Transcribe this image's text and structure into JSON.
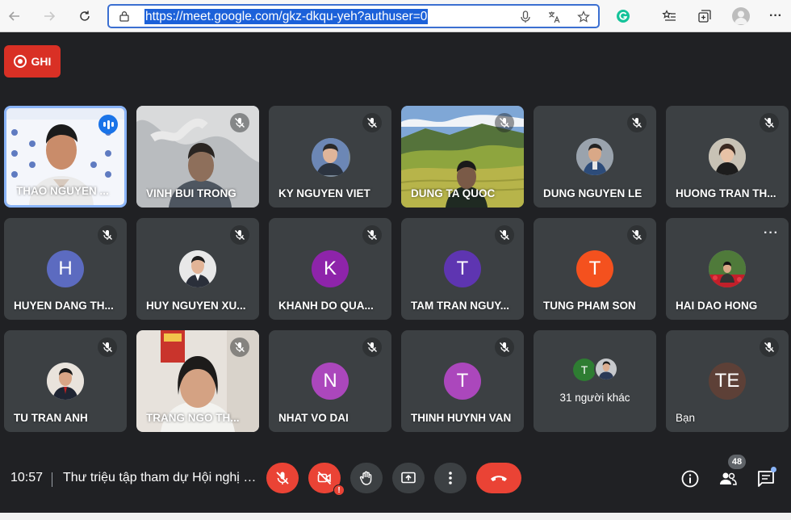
{
  "browser": {
    "url": "https://meet.google.com/gkz-dkqu-yeh?authuser=0"
  },
  "recording": {
    "label": "GHI",
    "color": "#d93025"
  },
  "tiles": [
    {
      "name": "THAO NGUYEN ...",
      "kind": "camera",
      "speaking": true
    },
    {
      "name": "VINH BUI TRONG",
      "kind": "camera",
      "muted": true
    },
    {
      "name": "KY NGUYEN VIET",
      "kind": "photo",
      "muted": true
    },
    {
      "name": "DUNG TA QUOC",
      "kind": "camera",
      "muted": true
    },
    {
      "name": "DUNG NGUYEN LE",
      "kind": "photo",
      "muted": true
    },
    {
      "name": "HUONG TRAN TH...",
      "kind": "photo",
      "muted": true
    },
    {
      "name": "HUYEN DANG TH...",
      "kind": "letter",
      "letter": "H",
      "color": "#5c6bc0",
      "muted": true
    },
    {
      "name": "HUY NGUYEN XU...",
      "kind": "photo",
      "muted": true
    },
    {
      "name": "KHANH DO QUA...",
      "kind": "letter",
      "letter": "K",
      "color": "#8e24aa",
      "muted": true
    },
    {
      "name": "TAM TRAN NGUY...",
      "kind": "letter",
      "letter": "T",
      "color": "#5e35b1",
      "muted": true
    },
    {
      "name": "TUNG PHAM SON",
      "kind": "letter",
      "letter": "T",
      "color": "#f4511e",
      "muted": true
    },
    {
      "name": "HAI DAO HONG",
      "kind": "photo",
      "more": true
    },
    {
      "name": "TU TRAN ANH",
      "kind": "photo",
      "muted": true
    },
    {
      "name": "TRANG NGO TH...",
      "kind": "camera",
      "muted": true
    },
    {
      "name": "NHAT VO DAI",
      "kind": "letter",
      "letter": "N",
      "color": "#ab47bc",
      "muted": true
    },
    {
      "name": "THINH HUYNH VAN",
      "kind": "letter",
      "letter": "T",
      "color": "#ab47bc",
      "muted": true
    },
    {
      "name": "31 người khác",
      "kind": "others",
      "letter": "T",
      "color": "#2e7d32"
    },
    {
      "name": "Bạn",
      "kind": "letter",
      "letter": "TE",
      "color": "#5d4037",
      "muted": true
    }
  ],
  "bottom_bar": {
    "time": "10:57",
    "meeting_title": "Thư triệu tập tham dự Hội nghị trực tuyến",
    "participants_count": "48",
    "warn_mark": "!"
  },
  "colors": {
    "background": "#202124",
    "tile": "#3c4043",
    "danger": "#ea4335",
    "active_border": "#8ab4f8"
  }
}
